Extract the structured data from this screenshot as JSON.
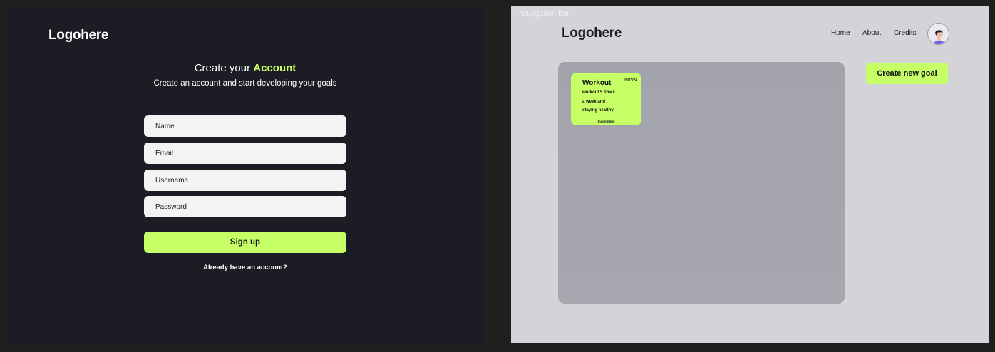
{
  "signup": {
    "logo": "Logohere",
    "heading_prefix": "Create your ",
    "heading_accent": "Account",
    "subheading": "Create an account and start developing your goals",
    "fields": [
      {
        "placeholder": "Name"
      },
      {
        "placeholder": "Email"
      },
      {
        "placeholder": "Username"
      },
      {
        "placeholder": "Password"
      }
    ],
    "signup_label": "Sign up",
    "login_link": "Already have an account?"
  },
  "dashboard": {
    "frame_label": "Navigation bar",
    "logo": "Logohere",
    "nav": {
      "home": "Home",
      "about": "About",
      "credits": "Credits"
    },
    "create_button": "Create new goal",
    "goal_card": {
      "title": "Workout",
      "date": "15/07/24",
      "description_lines": [
        "workout 5 times",
        "a week and",
        "staying healthy"
      ],
      "status": "Incomplete"
    }
  },
  "colors": {
    "accent": "#c6ff66",
    "dark_bg": "#1b1c24",
    "light_bg": "#d4d4d8",
    "board": "#a3a3ab",
    "field": "#f3f3f4"
  },
  "icons": {
    "avatar": "user-avatar-icon"
  }
}
